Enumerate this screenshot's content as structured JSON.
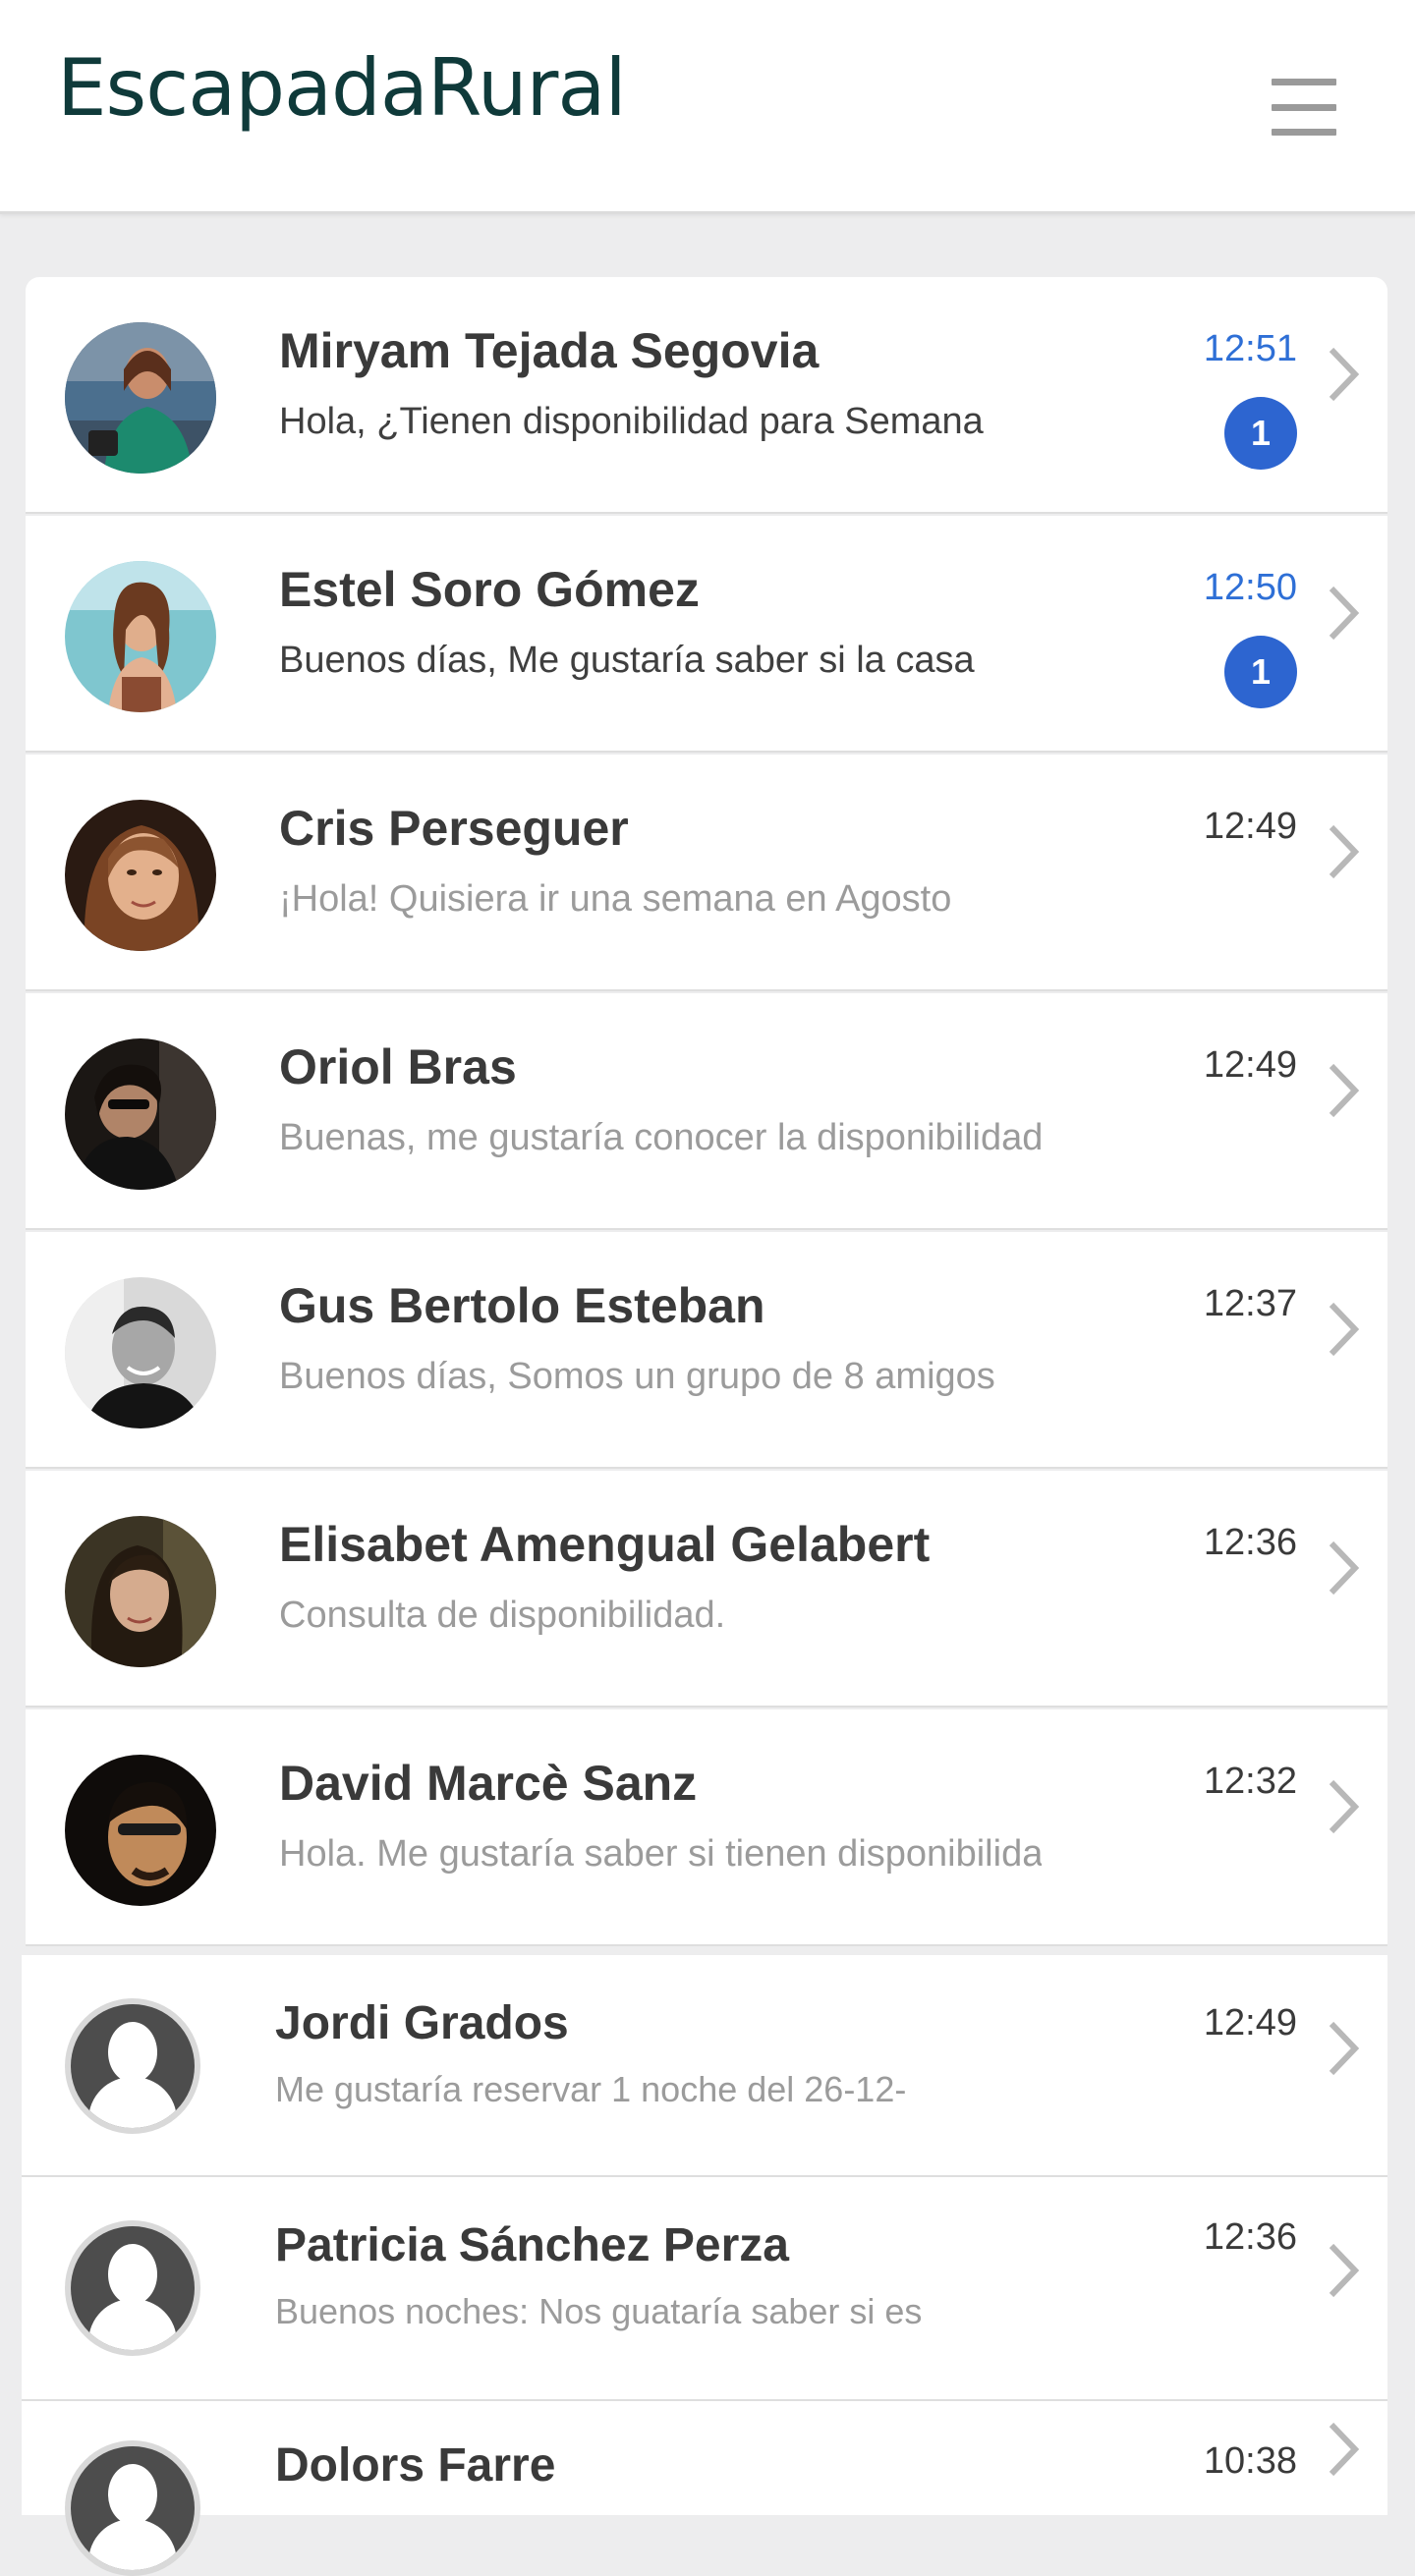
{
  "header": {
    "brand": "EscapadaRural"
  },
  "conversations": [
    {
      "name": "Miryam Tejada Segovia",
      "preview": "Hola, ¿Tienen disponibilidad para Semana",
      "time": "12:51",
      "badge": "1"
    },
    {
      "name": "Estel Soro Gómez",
      "preview": "Buenos días, Me gustaría saber si la casa",
      "time": "12:50",
      "badge": "1"
    },
    {
      "name": "Cris Perseguer",
      "preview": "¡Hola! Quisiera ir una semana en Agosto",
      "time": "12:49"
    },
    {
      "name": "Oriol Bras",
      "preview": "Buenas, me gustaría conocer la disponibilidad",
      "time": "12:49"
    },
    {
      "name": "Gus Bertolo Esteban",
      "preview": "Buenos días, Somos un grupo de 8 amigos",
      "time": "12:37"
    },
    {
      "name": "Elisabet Amengual Gelabert",
      "preview": "Consulta de disponibilidad.",
      "time": "12:36"
    },
    {
      "name": "David Marcè Sanz",
      "preview": "Hola. Me gustaría saber si tienen disponibilidad",
      "time": "12:32"
    },
    {
      "name": "Jordi Grados",
      "preview": "Me gustaría reservar 1 noche del 26-12-",
      "time": "12:49"
    },
    {
      "name": "Patricia Sánchez Perza",
      "preview": "Buenos noches: Nos guataría saber si es",
      "time": "12:36"
    },
    {
      "name": "Dolors Farre",
      "preview": "",
      "time": "10:38"
    }
  ]
}
